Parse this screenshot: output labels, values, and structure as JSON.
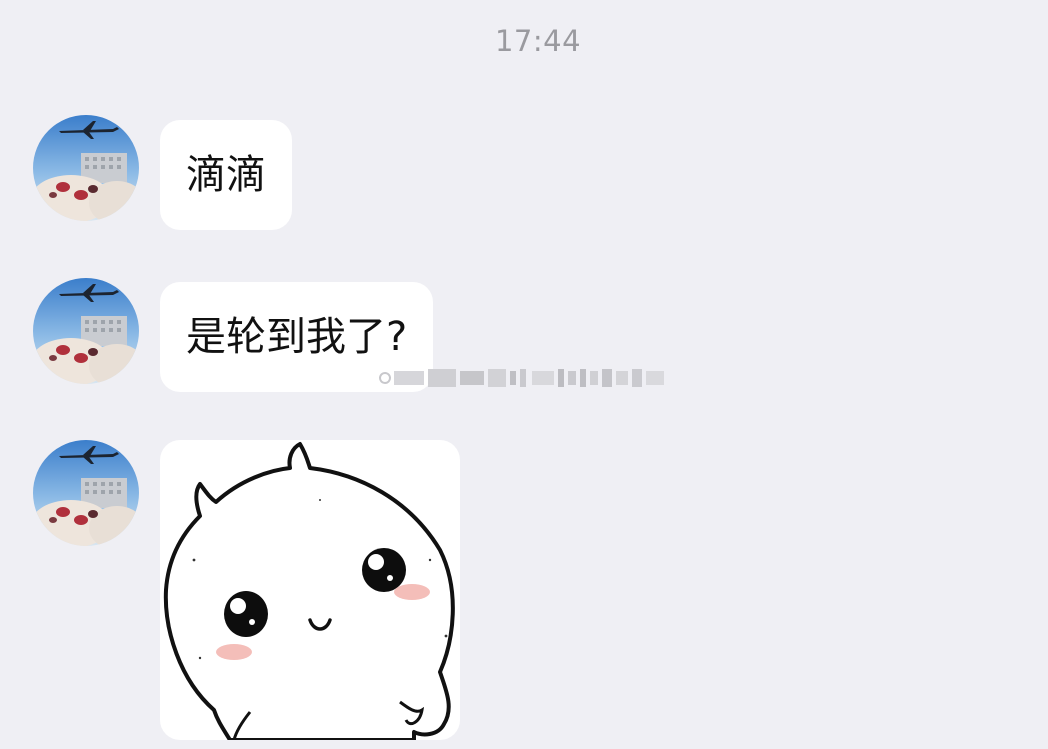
{
  "chat": {
    "timestamp": "17:44",
    "messages": [
      {
        "type": "text",
        "text": "滴滴"
      },
      {
        "type": "text",
        "text": "是轮到我了?"
      },
      {
        "type": "sticker",
        "sticker": "white-blob-character-sticker"
      }
    ]
  },
  "colors": {
    "background": "#efeff4",
    "bubble": "#ffffff",
    "timestamp_text": "#9a9a9f",
    "message_text": "#111111"
  },
  "icons": {
    "avatar": "avatar-airplane-cat-photo",
    "sticker": "white-blob-character-sticker"
  }
}
